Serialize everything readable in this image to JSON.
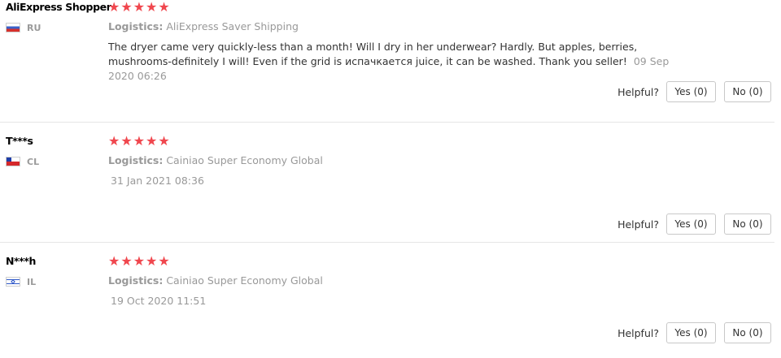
{
  "reviews": [
    {
      "user": "AliExpress Shopper",
      "country": "RU",
      "stars": "★★★★★",
      "logistics_label": "Logistics:",
      "logistics": "AliExpress Saver Shipping",
      "text": "The dryer came very quickly-less than a month! Will I dry in her underwear? Hardly. But apples, berries, mushrooms-definitely I will! Even if the grid is испачкается juice, it can be washed. Thank you seller!",
      "date": "09 Sep 2020 06:26",
      "rating": 5
    },
    {
      "user": "T***s",
      "country": "CL",
      "stars": "★★★★★",
      "logistics_label": "Logistics:",
      "logistics": "Cainiao Super Economy Global",
      "date": "31 Jan 2021 08:36",
      "rating": 5
    },
    {
      "user": "N***h",
      "country": "IL",
      "stars": "★★★★★",
      "logistics_label": "Logistics:",
      "logistics": "Cainiao Super Economy Global",
      "date": "19 Oct 2020 11:51",
      "rating": 5
    }
  ],
  "helpful": {
    "label": "Helpful?",
    "yes": "Yes (0)",
    "no": "No (0)"
  },
  "colors": {
    "star": "#f0474e",
    "muted": "#999999",
    "divider": "#e6e6e6"
  }
}
